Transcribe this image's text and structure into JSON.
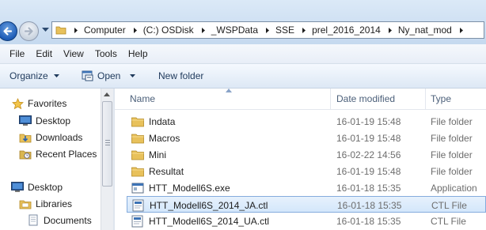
{
  "address": {
    "crumbs": [
      "Computer",
      "(C:) OSDisk",
      "_WSPData",
      "SSE",
      "prel_2016_2014",
      "Ny_nat_mod"
    ]
  },
  "menu": [
    "File",
    "Edit",
    "View",
    "Tools",
    "Help"
  ],
  "toolbar": {
    "organize": "Organize",
    "open": "Open",
    "new_folder": "New folder"
  },
  "nav": {
    "favorites": "Favorites",
    "desktop": "Desktop",
    "downloads": "Downloads",
    "recent_places": "Recent Places",
    "desktop_root": "Desktop",
    "libraries": "Libraries",
    "documents": "Documents"
  },
  "columns": {
    "name": "Name",
    "date": "Date modified",
    "type": "Type"
  },
  "files": [
    {
      "name": "Indata",
      "date": "16-01-19 15:48",
      "type": "File folder",
      "icon": "folder-icon"
    },
    {
      "name": "Macros",
      "date": "16-01-19 15:48",
      "type": "File folder",
      "icon": "folder-icon"
    },
    {
      "name": "Mini",
      "date": "16-02-22 14:56",
      "type": "File folder",
      "icon": "folder-icon"
    },
    {
      "name": "Resultat",
      "date": "16-01-19 15:48",
      "type": "File folder",
      "icon": "folder-icon"
    },
    {
      "name": "HTT_Modell6S.exe",
      "date": "16-01-18 15:35",
      "type": "Application",
      "icon": "application-icon"
    },
    {
      "name": "HTT_Modell6S_2014_JA.ctl",
      "date": "16-01-18 15:35",
      "type": "CTL File",
      "icon": "ctl-file-icon"
    },
    {
      "name": "HTT_Modell6S_2014_UA.ctl",
      "date": "16-01-18 15:35",
      "type": "CTL File",
      "icon": "ctl-file-icon"
    }
  ],
  "selected_file": "HTT_Modell6S_2014_JA.ctl",
  "colors": {
    "selection_bg": "#d4e7fb",
    "selection_border": "#84acdd",
    "folder": "#e8c15b",
    "toolbar_text": "#1e395b"
  }
}
